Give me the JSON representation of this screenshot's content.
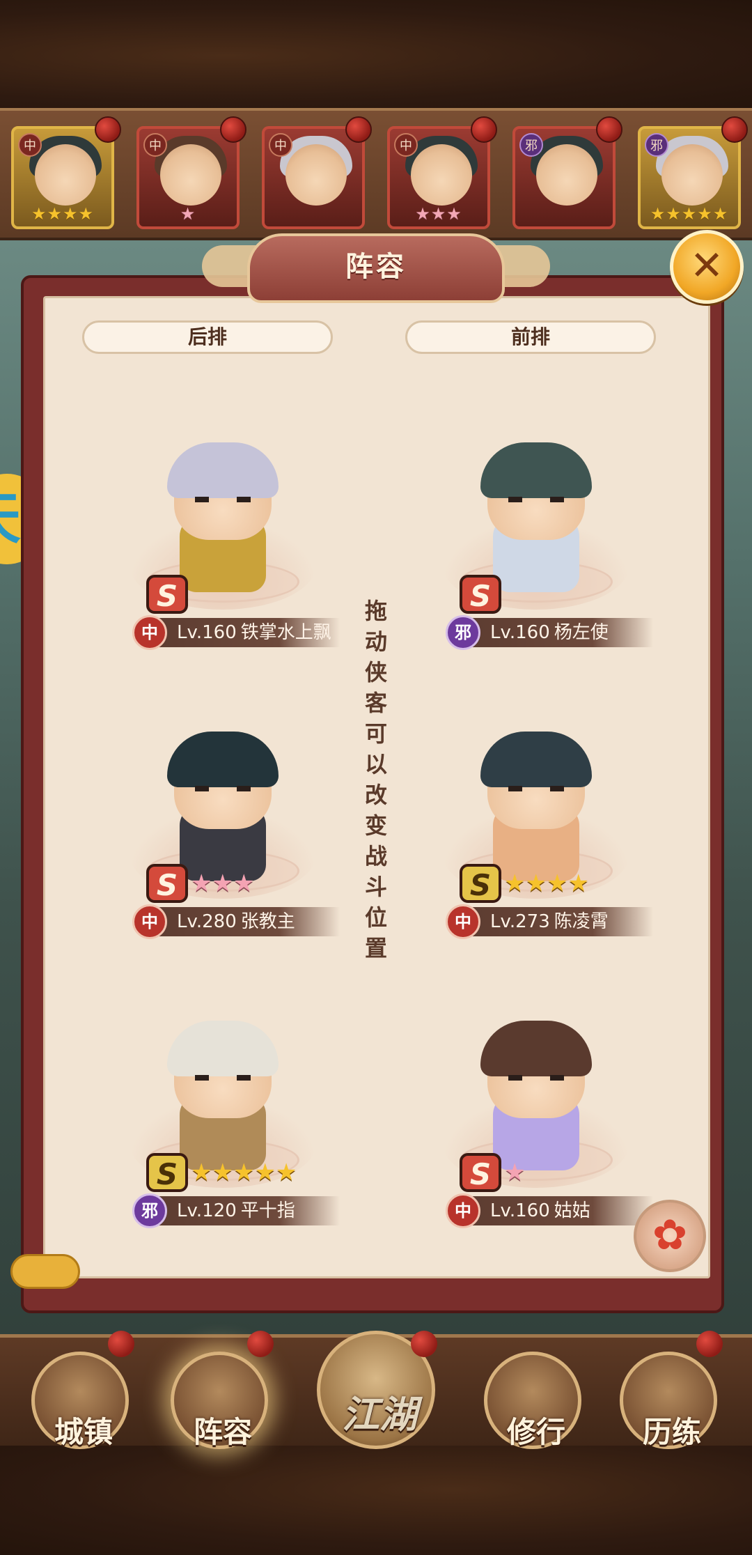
{
  "hero_strip": {
    "cards": [
      {
        "faction": "中",
        "stars": "★★★★",
        "star_color": "gold",
        "style": "gold",
        "hair": "dark"
      },
      {
        "faction": "中",
        "stars": "★",
        "star_color": "pink",
        "style": "red",
        "hair": "brown"
      },
      {
        "faction": "中",
        "stars": "",
        "star_color": "gold",
        "style": "red",
        "hair": "gray"
      },
      {
        "faction": "中",
        "stars": "★★★",
        "star_color": "pink",
        "style": "red",
        "hair": "dark"
      },
      {
        "faction": "邪",
        "stars": "",
        "star_color": "gold",
        "style": "red",
        "hair": "dark"
      },
      {
        "faction": "邪",
        "stars": "★★★★★",
        "star_color": "gold",
        "style": "gold",
        "hair": "gray"
      }
    ]
  },
  "dialog": {
    "title": "阵容",
    "close_icon": "✕",
    "back_row_label": "后排",
    "front_row_label": "前排",
    "hint": "拖动侠客可以改变战斗位置",
    "slots": [
      {
        "faction": "中",
        "level": "Lv.160",
        "name": "铁掌水上飘",
        "rank": "S",
        "rank_color": "red",
        "stars": "",
        "star_color": "gold",
        "hair": "#c5c3d8",
        "body": "#c9a23a"
      },
      {
        "faction": "邪",
        "level": "Lv.160",
        "name": "杨左使",
        "rank": "S",
        "rank_color": "red",
        "stars": "",
        "star_color": "gold",
        "hair": "#3f5552",
        "body": "#cfd8e6"
      },
      {
        "faction": "中",
        "level": "Lv.280",
        "name": "张教主",
        "rank": "S",
        "rank_color": "red",
        "stars": "★★★",
        "star_color": "pink",
        "hair": "#23343a",
        "body": "#3a3a42"
      },
      {
        "faction": "中",
        "level": "Lv.273",
        "name": "陈凌霄",
        "rank": "S",
        "rank_color": "gold",
        "stars": "★★★★",
        "star_color": "gold",
        "hair": "#2f3e46",
        "body": "#e8b084"
      },
      {
        "faction": "邪",
        "level": "Lv.120",
        "name": "平十指",
        "rank": "S",
        "rank_color": "gold",
        "stars": "★★★★★",
        "star_color": "gold",
        "hair": "#e6e2d8",
        "body": "#b08b58"
      },
      {
        "faction": "中",
        "level": "Lv.160",
        "name": "姑姑",
        "rank": "S",
        "rank_color": "red",
        "stars": "★",
        "star_color": "pink",
        "hair": "#5a3a2e",
        "body": "#b7a6e6"
      }
    ]
  },
  "side_badge": {
    "text": "天"
  },
  "bottom_nav": {
    "items": [
      {
        "label": "城镇",
        "icon": "town-icon"
      },
      {
        "label": "阵容",
        "icon": "lineup-icon"
      },
      {
        "label": "江湖",
        "icon": "jianghu-scroll-icon"
      },
      {
        "label": "修行",
        "icon": "training-icon"
      },
      {
        "label": "历练",
        "icon": "experience-icon"
      }
    ]
  }
}
